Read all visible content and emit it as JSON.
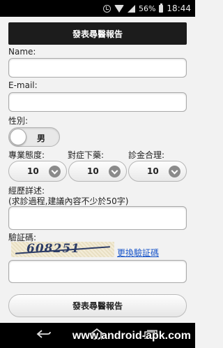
{
  "status_bar": {
    "battery_percent": "56%",
    "time": "18:44"
  },
  "form": {
    "title": "發表尋醫報告",
    "name_label": "Name:",
    "email_label": "E-mail:",
    "gender_label": "性別:",
    "gender_value": "男",
    "ratings": [
      {
        "label": "專業態度:",
        "value": "10"
      },
      {
        "label": "對症下藥:",
        "value": "10"
      },
      {
        "label": "診金合理:",
        "value": "10"
      }
    ],
    "experience_label": "經歷詳述:",
    "experience_hint": "(求診過程,建議內容不少於50字)",
    "captcha_label": "驗証碼:",
    "captcha_text": "608251",
    "captcha_refresh": "更換驗証碼",
    "submit_label": "發表尋醫報告"
  },
  "watermark": "www.android-apk.com",
  "icons": [
    "alarm-icon",
    "wifi-icon",
    "signal-icon",
    "battery-icon",
    "back-icon",
    "home-icon",
    "recent-apps-icon"
  ]
}
